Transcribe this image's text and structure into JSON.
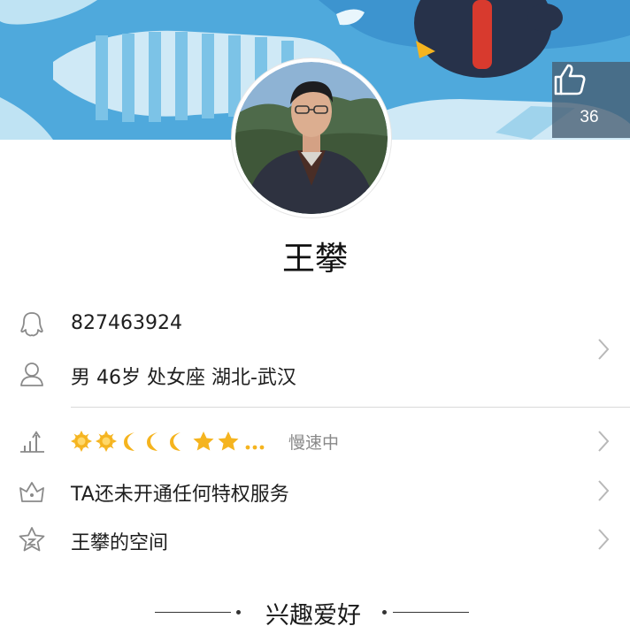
{
  "profile": {
    "name": "王攀",
    "likes": "36",
    "qq_number": "827463924",
    "details": "男 46岁 处女座 湖北-武汉"
  },
  "level": {
    "badges": [
      "sun",
      "sun",
      "moon",
      "moon",
      "moon",
      "star",
      "star"
    ],
    "ellipsis": "...",
    "status": "慢速中"
  },
  "privileges": {
    "label": "TA还未开通任何特权服务"
  },
  "space": {
    "label": "王攀的空间"
  },
  "interests": {
    "heading": "兴趣爱好"
  },
  "theme": {
    "banner_color": "#4fa9dc",
    "badge_gold": "#f5b41f",
    "icon_gray": "#8a8a8a"
  }
}
